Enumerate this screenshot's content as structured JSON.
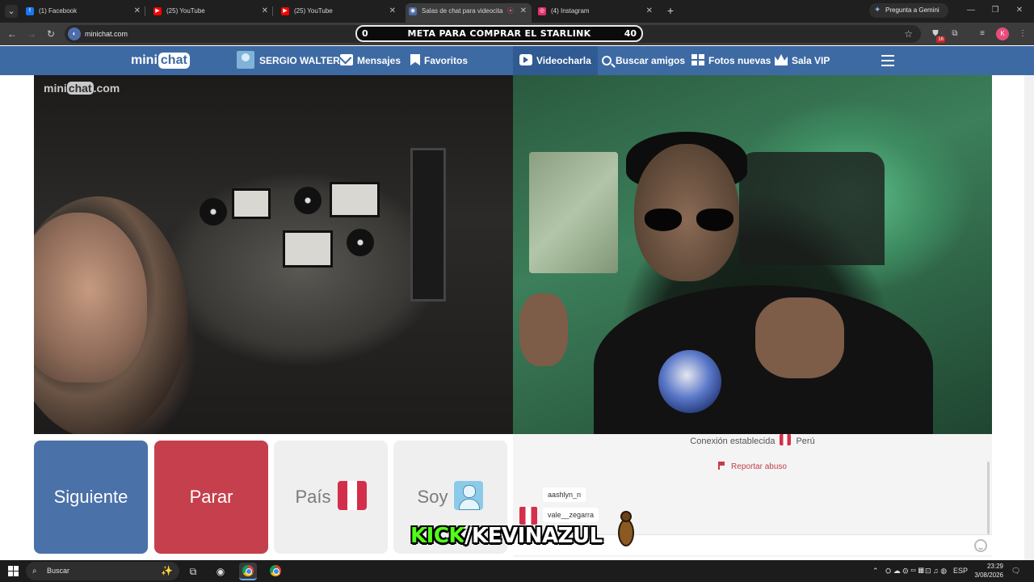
{
  "browser": {
    "tabs": [
      {
        "label": "(1) Facebook",
        "icon": "facebook-icon",
        "color": "#1877f2"
      },
      {
        "label": "(25) YouTube",
        "icon": "youtube-icon",
        "color": "#ff0000"
      },
      {
        "label": "(25) YouTube",
        "icon": "youtube-icon",
        "color": "#ff0000"
      },
      {
        "label": "Salas de chat para videocita",
        "icon": "minichat-icon",
        "color": "#4b6ea8",
        "active": true
      },
      {
        "label": "(4) Instagram",
        "icon": "instagram-icon",
        "color": "#e1306c"
      }
    ],
    "gemini_label": "Pregunta a Gemini",
    "url": "minichat.com",
    "extension_badge": "16",
    "profile_initial": "K"
  },
  "overlay": {
    "goal_start": "0",
    "goal_title": "META PARA COMPRAR EL STARLINK",
    "goal_end": "40",
    "kick_prefix": "KICK",
    "kick_rest": "/KEVINAZUL"
  },
  "header": {
    "logo_prefix": "mini",
    "logo_bubble": "chat",
    "username": "SERGIO WALTER",
    "nav_left": [
      "Mensajes",
      "Favoritos"
    ],
    "nav_right": [
      "Videocharla",
      "Buscar amigos",
      "Fotos nuevas",
      "Sala VIP"
    ],
    "active_item": "Videocharla"
  },
  "video": {
    "watermark_prefix": "mini",
    "watermark_bubble": "chat",
    "watermark_suffix": ".com"
  },
  "controls": {
    "next_label": "Siguiente",
    "stop_label": "Parar",
    "country_label": "País",
    "gender_label": "Soy"
  },
  "chat": {
    "status": "Conexión establecida",
    "country": "Perú",
    "report_label": "Reportar abuso",
    "messages": [
      "aashlyn_n",
      "vale__zegarra"
    ]
  },
  "taskbar": {
    "search_placeholder": "Buscar",
    "language": "ESP",
    "time": "23:29",
    "date": "3/08/2026"
  },
  "colors": {
    "header_blue": "#3e6aa3",
    "next_button": "#4a71a8",
    "stop_button": "#c5404c",
    "report_red": "#c33d4a",
    "kick_green": "#53fc18"
  }
}
